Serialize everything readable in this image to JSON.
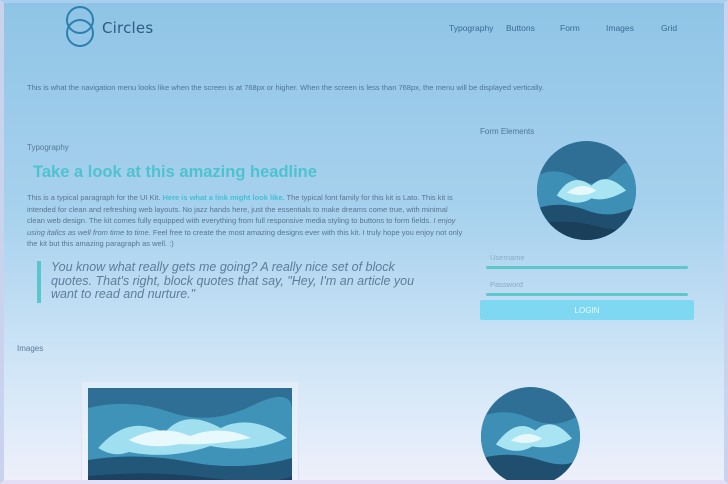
{
  "brand": {
    "name": "Circles"
  },
  "nav": {
    "items": [
      {
        "label": "Typography"
      },
      {
        "label": "Buttons"
      },
      {
        "label": "Form"
      },
      {
        "label": "Images"
      },
      {
        "label": "Grid"
      }
    ]
  },
  "nav_note": "This is what the navigation menu looks like when the screen is at 768px or higher. When the screen is less than 768px, the menu will be displayed vertically.",
  "typography": {
    "section_label": "Typography",
    "headline": "Take a look at this amazing headline",
    "paragraph": {
      "part1": "This is a typical paragraph for the UI Kit. ",
      "link": "Here is what a link might look like.",
      "part2": " The typical font family for this kit is Lato. This kit is intended for clean and refreshing web layouts. No jazz hands here, just the essentials to make dreams come true, with minimal clean web design. The kit comes fully equipped with everything from full responsive media styling to buttons to form fields. ",
      "italic": "I enjoy using italics as well from time to time.",
      "part3": " Feel free to create the most amazing designs ever with this kit. I truly hope you enjoy not only the kit but this amazing paragraph as well. :)"
    },
    "quote": "You know what really gets me going? A really nice set of block quotes. That's right, block quotes that say, \"Hey, I'm an article you want to read and nurture.\""
  },
  "form": {
    "section_label": "Form Elements",
    "username_placeholder": "Username",
    "password_placeholder": "Password",
    "login_label": "LOGIN"
  },
  "images": {
    "section_label": "Images"
  },
  "colors": {
    "accent": "#4fc2cf",
    "button": "#7fd8f2",
    "link": "#45bfd2",
    "logo": "#2d6f9e"
  }
}
